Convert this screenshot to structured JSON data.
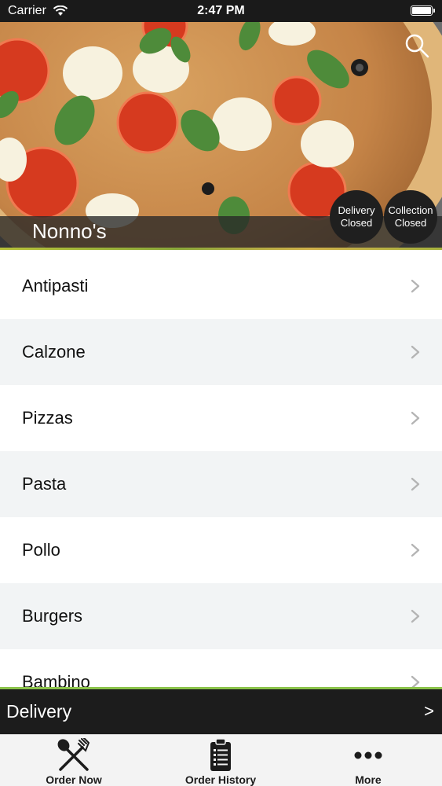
{
  "status_bar": {
    "carrier": "Carrier",
    "time": "2:47 PM"
  },
  "hero": {
    "restaurant_name": "Nonno's",
    "search_icon": "search-icon",
    "delivery_status": {
      "line1": "Delivery",
      "line2": "Closed"
    },
    "collection_status": {
      "line1": "Collection",
      "line2": "Closed"
    }
  },
  "menu": {
    "items": [
      {
        "label": "Antipasti"
      },
      {
        "label": "Calzone"
      },
      {
        "label": "Pizzas"
      },
      {
        "label": "Pasta"
      },
      {
        "label": "Pollo"
      },
      {
        "label": "Burgers"
      },
      {
        "label": "Bambino"
      }
    ],
    "chevron_icon": "chevron-right-icon"
  },
  "order_bar": {
    "mode": "Delivery",
    "arrow": ">"
  },
  "tab_bar": {
    "tabs": [
      {
        "label": "Order Now",
        "icon": "fork-knife-icon"
      },
      {
        "label": "Order History",
        "icon": "clipboard-list-icon"
      },
      {
        "label": "More",
        "icon": "more-dots-icon"
      }
    ]
  },
  "colors": {
    "accent_green": "#8bc34a",
    "dark_bar": "#1c1c1c",
    "row_alt": "#f2f4f5"
  }
}
